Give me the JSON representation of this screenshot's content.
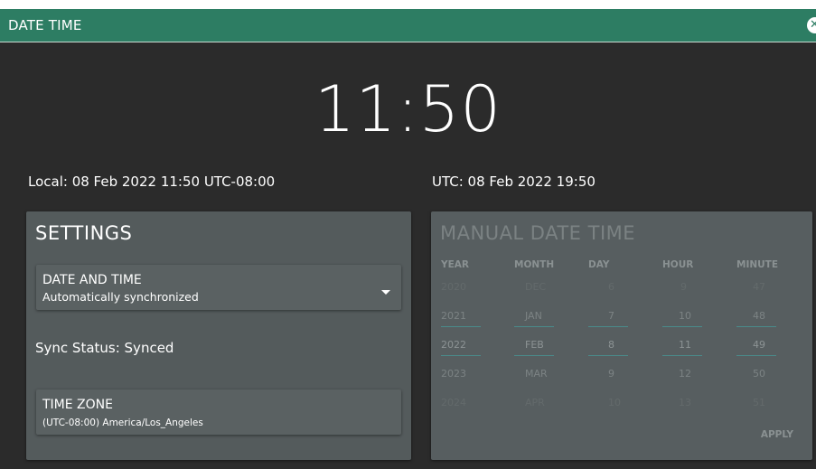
{
  "window": {
    "title": "DATE TIME",
    "close_icon": "close-icon"
  },
  "clock": {
    "time": "11:50"
  },
  "times": {
    "local": "Local: 08 Feb 2022 11:50 UTC-08:00",
    "utc": "UTC: 08 Feb 2022 19:50"
  },
  "settings": {
    "title": "SETTINGS",
    "date_and_time": {
      "label": "DATE AND TIME",
      "value": "Automatically synchronized"
    },
    "sync_status": "Sync Status: Synced",
    "time_zone": {
      "label": "TIME ZONE",
      "value": "(UTC-08:00) America/Los_Angeles"
    }
  },
  "manual": {
    "title": "MANUAL DATE TIME",
    "columns": [
      {
        "header": "YEAR",
        "items": [
          "2020",
          "2021",
          "2022",
          "2023",
          "2024"
        ]
      },
      {
        "header": "MONTH",
        "items": [
          "DEC",
          "JAN",
          "FEB",
          "MAR",
          "APR"
        ]
      },
      {
        "header": "DAY",
        "items": [
          "6",
          "7",
          "8",
          "9",
          "10"
        ]
      },
      {
        "header": "HOUR",
        "items": [
          "9",
          "10",
          "11",
          "12",
          "13"
        ]
      },
      {
        "header": "MINUTE",
        "items": [
          "47",
          "48",
          "49",
          "50",
          "51"
        ]
      }
    ],
    "apply_label": "APPLY"
  },
  "colors": {
    "titlebar": "#2d7d63",
    "background": "#2b2b2b",
    "panel": "#545b5c"
  }
}
